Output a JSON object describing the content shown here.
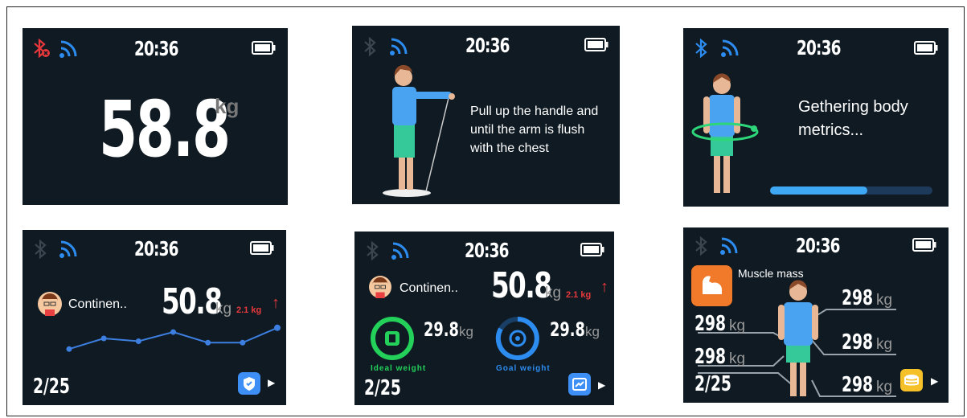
{
  "status": {
    "time": "20:36"
  },
  "screen1": {
    "weight": "58.8",
    "unit": "kg"
  },
  "screen2": {
    "instruction_1": "Pull up the handle and",
    "instruction_2": "until the arm is flush",
    "instruction_3": "with the chest"
  },
  "screen3": {
    "message_1": "Gethering body",
    "message_2": "metrics...",
    "progress": 0.6
  },
  "screen4": {
    "user_name": "Continen..",
    "weight": "50.8",
    "unit": "kg",
    "delta": "2.1 kg",
    "page": "2/25",
    "trend": [
      0.2,
      0.5,
      0.42,
      0.68,
      0.38,
      0.38,
      0.8
    ]
  },
  "screen5": {
    "user_name": "Continen..",
    "weight": "50.8",
    "unit": "kg",
    "delta": "2.1 kg",
    "ideal_value": "29.8",
    "ideal_unit": "kg",
    "ideal_label": "Ideal weight",
    "goal_value": "29.8",
    "goal_unit": "kg",
    "goal_label": "Goal weight",
    "page": "2/25"
  },
  "screen6": {
    "title": "Muscle mass",
    "page": "2/25",
    "left_1": "298",
    "left_2": "298",
    "right_1": "298",
    "right_2": "298",
    "right_3": "298",
    "unit": "kg"
  },
  "colors": {
    "bg": "#0f1a23",
    "accent": "#2d8cf0",
    "red": "#e8383b",
    "green": "#22d05a",
    "orange": "#f07a2a",
    "yellow": "#f5c028"
  }
}
